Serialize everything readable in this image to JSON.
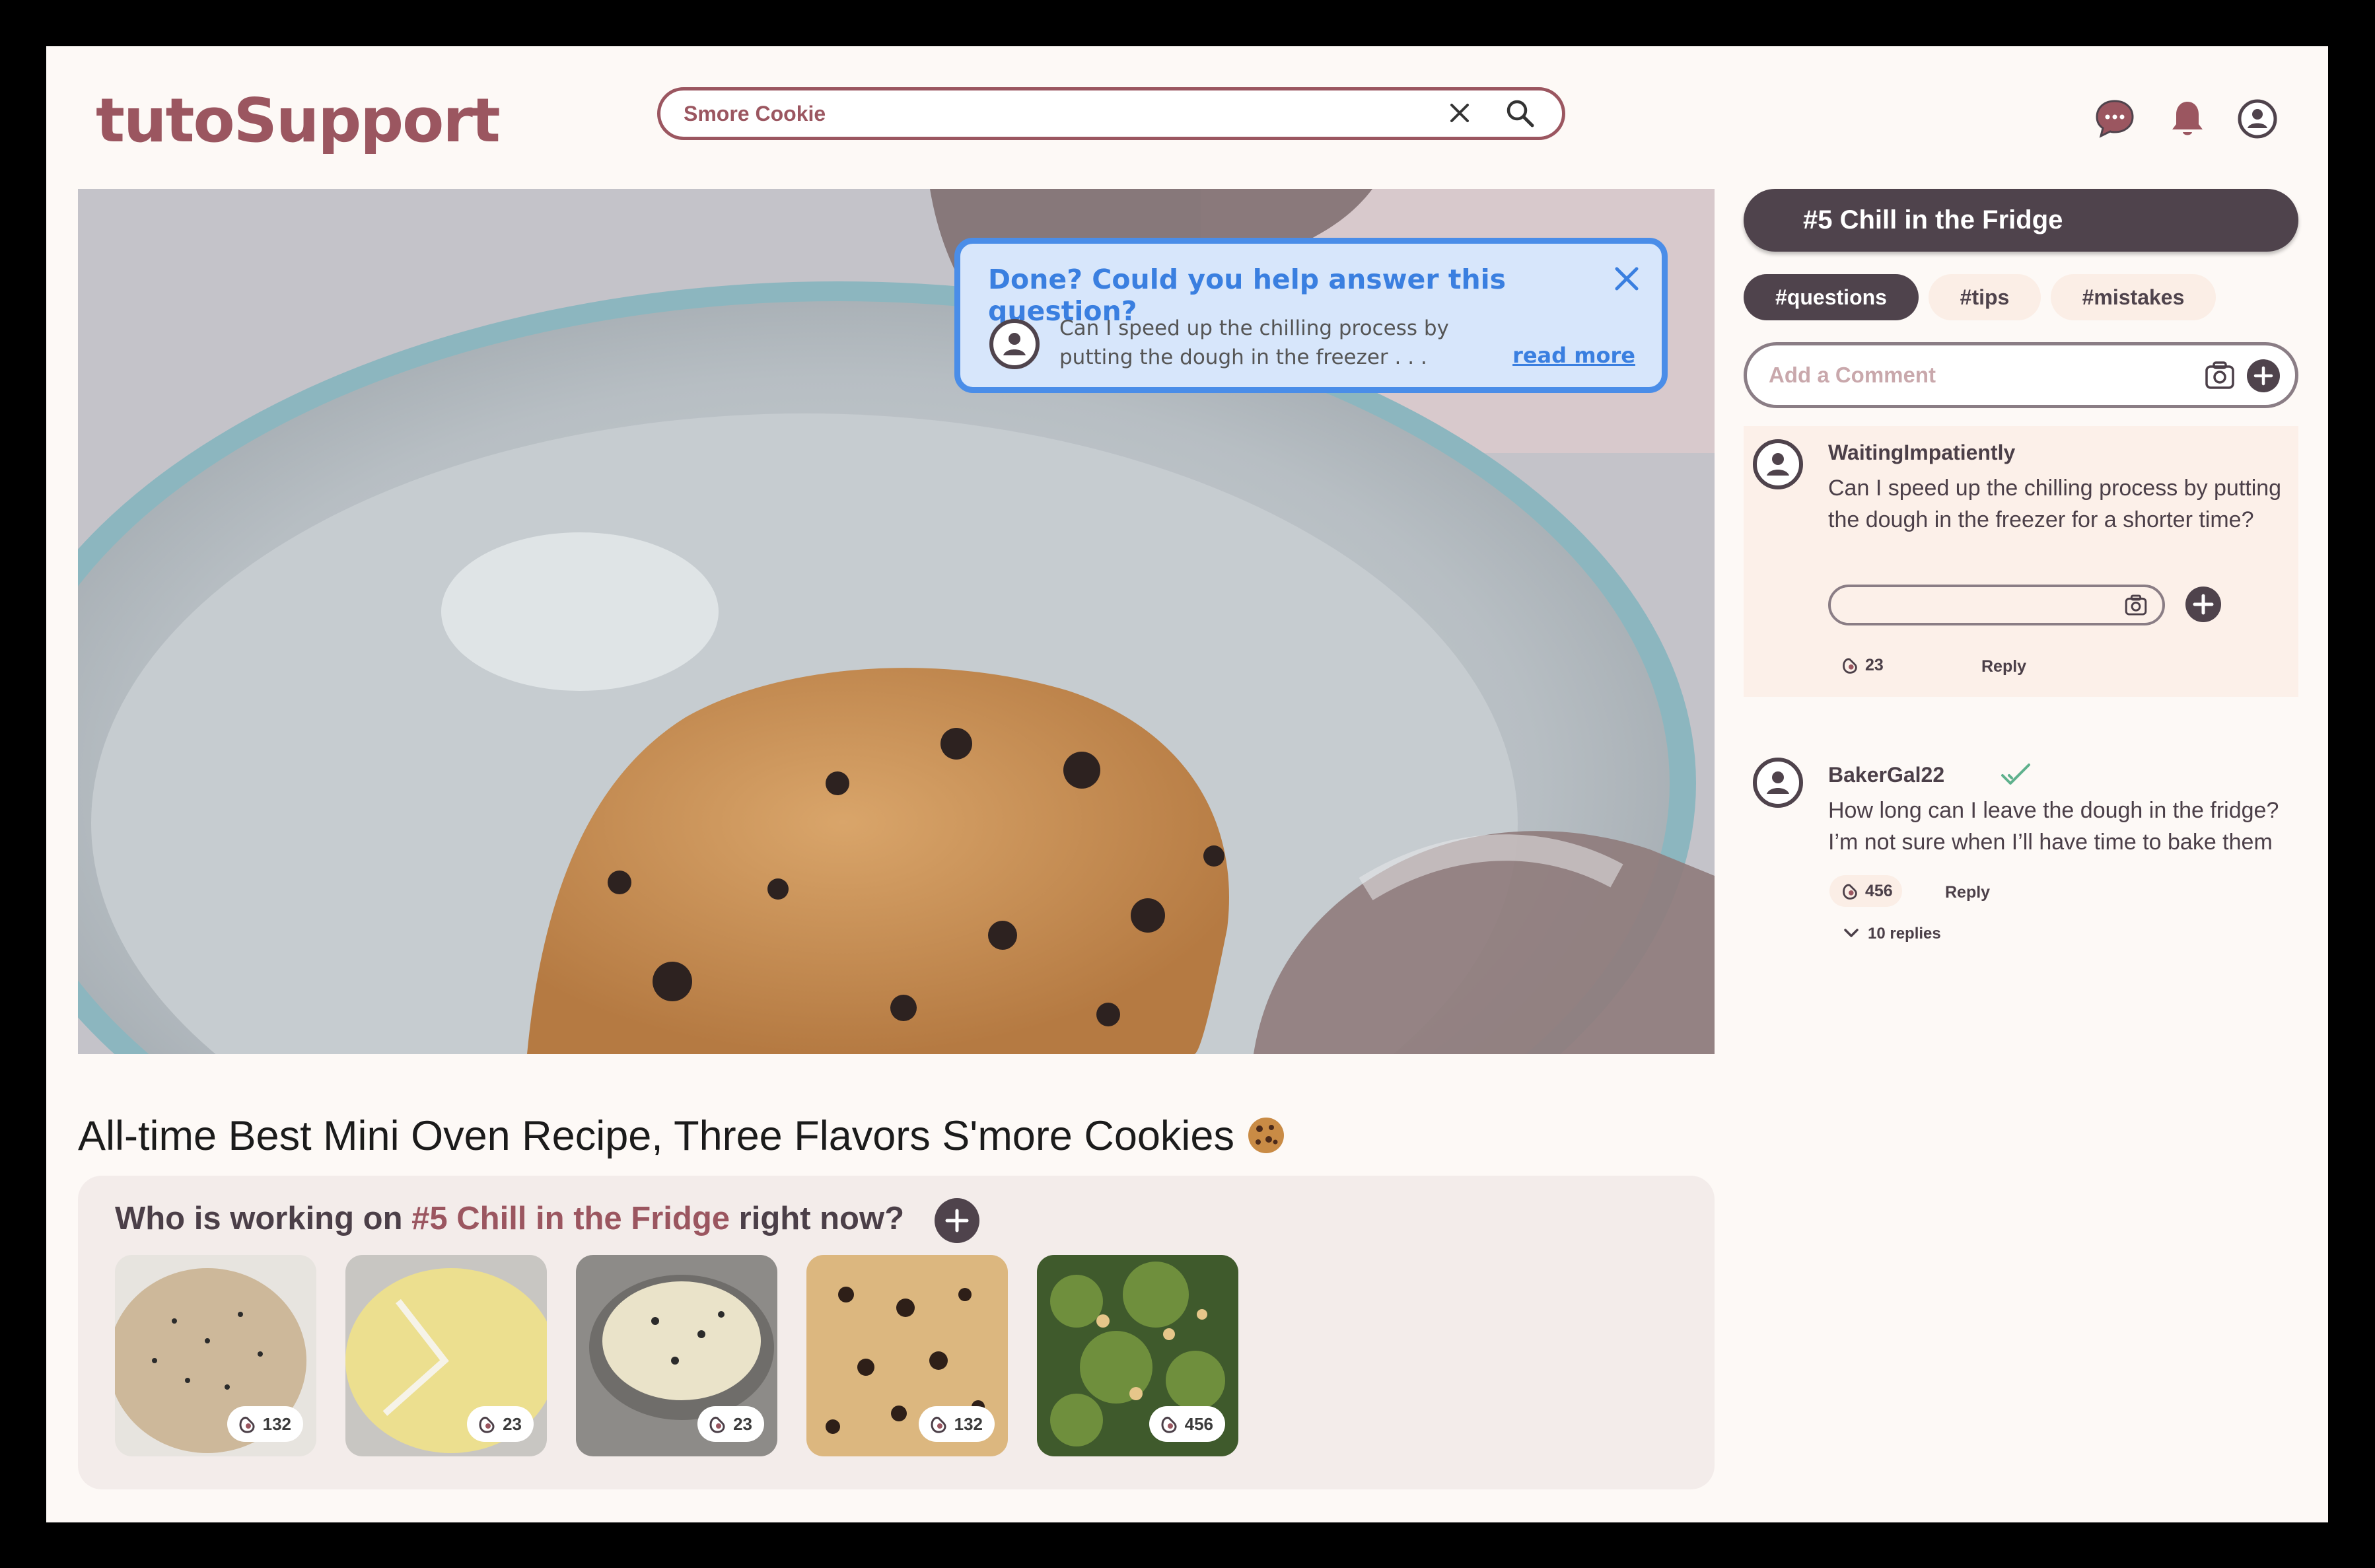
{
  "app": {
    "logo_text": "tutoSupport"
  },
  "search": {
    "query": "Smore Cookie"
  },
  "header_icons": [
    "chat-bubble-icon",
    "bell-icon",
    "user-account-icon"
  ],
  "popup": {
    "title": "Done? Could you help answer this question?",
    "question": "Can I speed up the chilling process by putting the dough in the freezer . . .",
    "link": "read more"
  },
  "video": {
    "title": "All-time Best Mini Oven Recipe, Three Flavors S'more Cookies"
  },
  "working": {
    "prefix": "Who is working on ",
    "step": "#5 Chill in the Fridge",
    "suffix": " right now?",
    "thumbs": [
      {
        "likes": "132"
      },
      {
        "likes": "23"
      },
      {
        "likes": "23"
      },
      {
        "likes": "132"
      },
      {
        "likes": "456"
      }
    ]
  },
  "sidebar": {
    "step_title": "#5 Chill in the Fridge",
    "chips": [
      "#questions",
      "#tips",
      "#mistakes"
    ],
    "active_chip": "#questions",
    "comment_placeholder": "Add a Comment",
    "comments": [
      {
        "user": "WaitingImpatiently",
        "text": "Can I speed up the chilling process by putting the dough in the freezer for a shorter time?",
        "likes": "23",
        "reply": "Reply"
      },
      {
        "user": "BakerGal22",
        "verified": true,
        "text": "How long can I leave the dough in the fridge? I’m not sure when I’ll have time to bake them",
        "likes": "456",
        "reply": "Reply",
        "replies": "10 replies"
      }
    ]
  },
  "colors": {
    "brand": "#9b5660",
    "dark": "#4f434c",
    "accent_blue": "#4a8de8",
    "bg": "#fdf9f6"
  }
}
